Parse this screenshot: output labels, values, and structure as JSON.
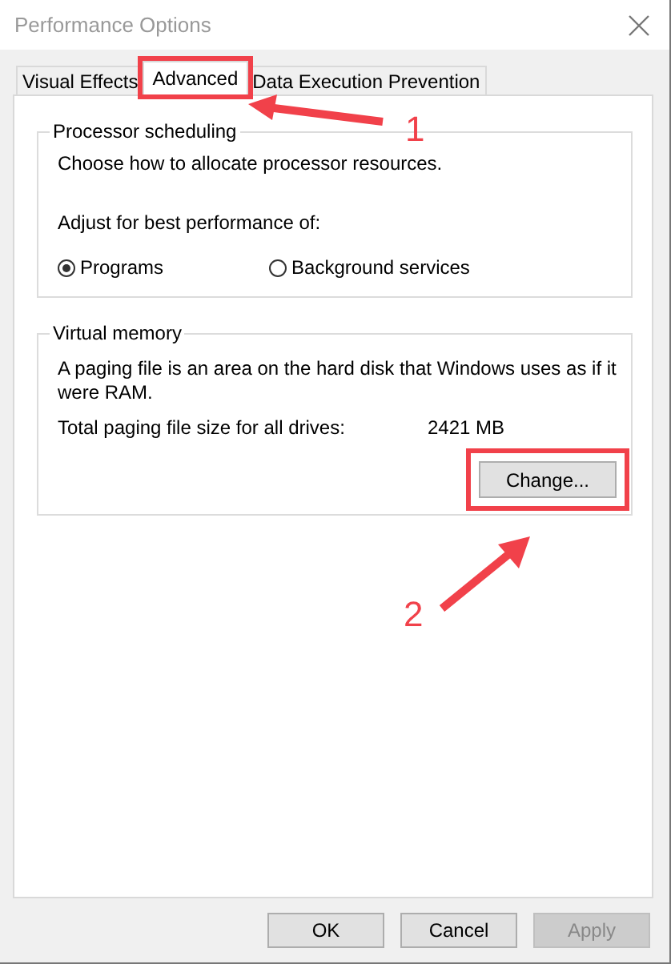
{
  "window": {
    "title": "Performance Options"
  },
  "tabs": [
    {
      "label": "Visual Effects",
      "selected": false,
      "highlighted": false
    },
    {
      "label": "Advanced",
      "selected": true,
      "highlighted": true
    },
    {
      "label": "Data Execution Prevention",
      "selected": false,
      "highlighted": false
    }
  ],
  "processor_scheduling": {
    "title": "Processor scheduling",
    "description": "Choose how to allocate processor resources.",
    "prompt": "Adjust for best performance of:",
    "options": [
      {
        "label": "Programs",
        "selected": true
      },
      {
        "label": "Background services",
        "selected": false
      }
    ]
  },
  "virtual_memory": {
    "title": "Virtual memory",
    "description": "A paging file is an area on the hard disk that Windows uses as if it were RAM.",
    "total_label": "Total paging file size for all drives:",
    "total_value": "2421 MB",
    "button": {
      "label": "Change...",
      "highlighted": true
    }
  },
  "buttons": [
    {
      "label": "OK",
      "disabled": false
    },
    {
      "label": "Cancel",
      "disabled": false
    },
    {
      "label": "Apply",
      "disabled": true
    }
  ],
  "annotations": [
    {
      "label": "1",
      "kind": "left"
    },
    {
      "label": "2",
      "kind": "up"
    }
  ]
}
